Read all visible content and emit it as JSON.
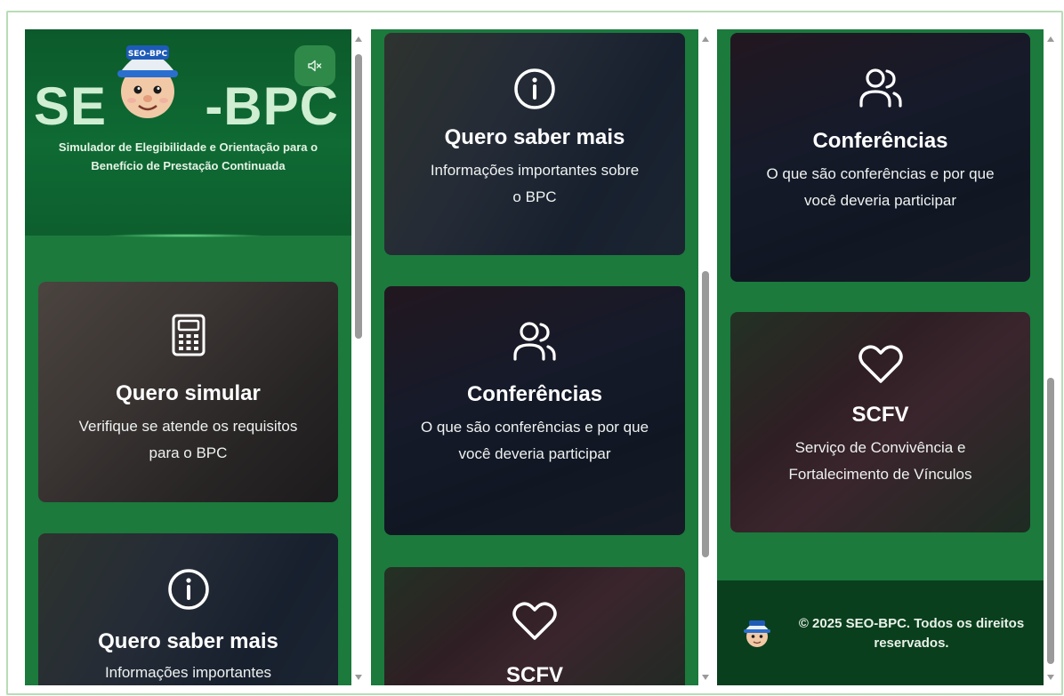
{
  "header": {
    "logo_left": "SE",
    "logo_right": "-BPC",
    "mascot_cap_text": "SEO-BPC",
    "mute_icon": "speaker-muted-icon",
    "subtitle": "Simulador de Elegibilidade e Orientação para o Benefício de Prestação Continuada"
  },
  "cards": {
    "simular": {
      "title": "Quero simular",
      "desc": "Verifique se atende os requisitos para o BPC",
      "icon": "calculator-icon"
    },
    "saber": {
      "title": "Quero saber mais",
      "desc": "Informações importantes sobre o BPC",
      "icon": "info-icon"
    },
    "conferencias": {
      "title": "Conferências",
      "desc": "O que são conferências e por que você deveria participar",
      "icon": "users-icon"
    },
    "scfv": {
      "title": "SCFV",
      "desc": "Serviço de Convivência e Fortalecimento de Vínculos",
      "icon": "heart-icon"
    },
    "saber_partial_desc": "Informações importantes"
  },
  "footer": {
    "text": "© 2025 SEO-BPC. Todos os direitos reservados."
  },
  "colors": {
    "page_green": "#1b7a3c",
    "header_green": "#0f6a33",
    "footer_green": "#0a3f1d",
    "logo_text": "#cfeed2"
  }
}
